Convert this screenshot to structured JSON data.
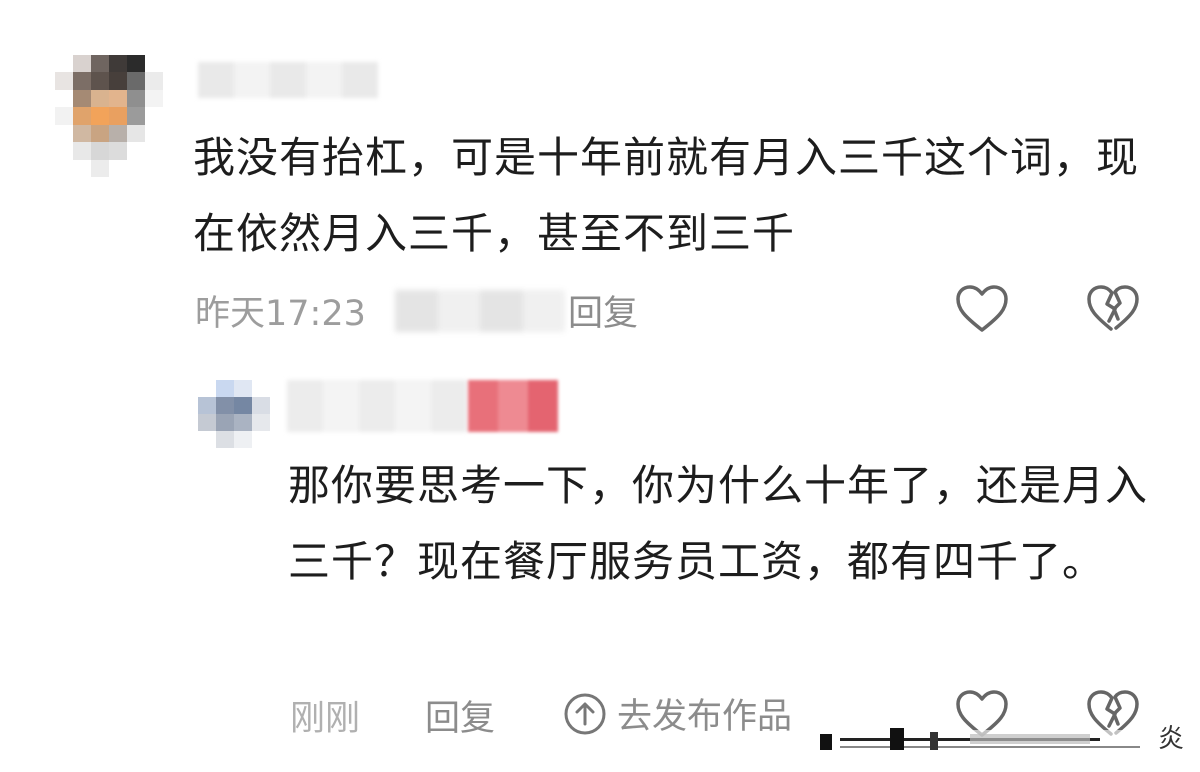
{
  "comment": {
    "text": "我没有抬杠，可是十年前就有月入三千这个词，现在依然月入三千，甚至不到三千",
    "time": "昨天17:23",
    "reply_label": "回复"
  },
  "reply": {
    "text": "那你要思考一下，你为什么十年了，还是月入三千？现在餐厅服务员工资，都有四千了。",
    "time": "刚刚",
    "reply_label": "回复",
    "publish_label": "去发布作品"
  },
  "watermark": {
    "trailing_char": "炎"
  },
  "colors": {
    "meta_text": "#9d9d9d",
    "badge": "#e8707a",
    "icon_stroke": "#666666"
  },
  "icons": [
    "heart-icon",
    "broken-heart-icon",
    "arrow-up-circle-icon"
  ]
}
